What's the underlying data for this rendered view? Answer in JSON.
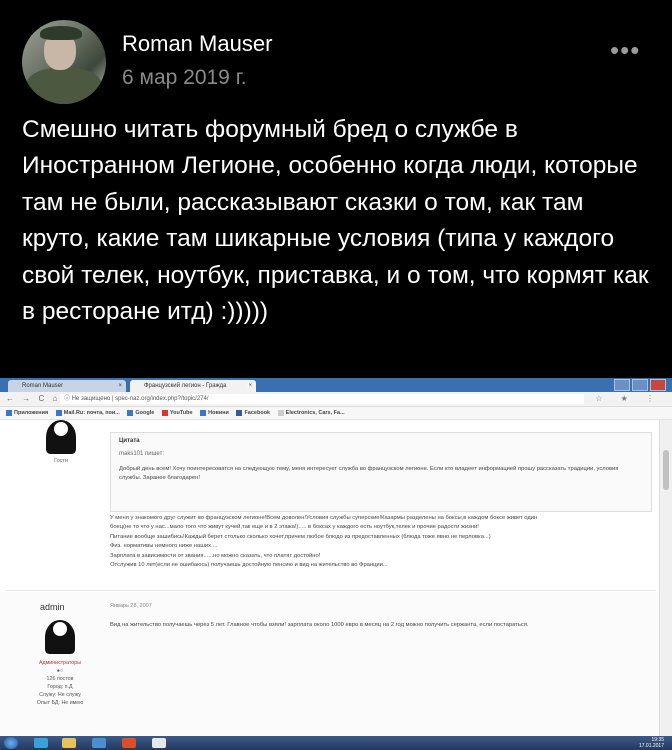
{
  "post": {
    "author": "Roman Mauser",
    "date": "6 мар 2019 г.",
    "more_glyph": "•••",
    "text": "Смешно читать форумный бред о службе в Иностранном Легионе, особенно когда люди, которые там не были, рассказывают сказки о том, как там круто, какие там шикарные условия (типа у каждого свой телек, ноутбук, приставка, и о том, что кормят как в ресторане итд) :)))))"
  },
  "browser": {
    "tabs": [
      {
        "label": "Roman Mauser",
        "close": "×"
      },
      {
        "label": "Французский легион - Гражда",
        "close": "×"
      }
    ],
    "new_tab": "+",
    "nav_glyphs": "← → C ⌂",
    "url": "ⓘ Не защищено | spec-naz.org/index.php?/topic/274/",
    "addr_icons": "☆ ★ ⋮",
    "bookmarks": [
      "Приложения",
      "Mail.Ru: почта, пои...",
      "Google",
      "YouTube",
      "Новини",
      "Facebook",
      "Electronics, Cars, Fa..."
    ]
  },
  "forum": {
    "guest_label": "Гости",
    "quote_title": "Цитата",
    "quote_author": "maks101 пишет:",
    "quote_text": "Добрый день всем! Хочу поинтересоватся на следующую тему, меня интересует служба во французском легионе. Если кто владеет информацией прошу рассказать традиции, условия службы. Заранее благодарен!",
    "message": [
      "У меня у знакомого друг служит во французском легионе!Всем доволен!Условия службы суперские!Казармы разделены на боксы,в каждом боксе живет один",
      "боец(не то что у нас...мало того что живут кучей,так еще и в 2 этажа!)..... в боксах у каждого есть ноутбук,телек и прочие радости жизни!",
      "Питание вообще зашибись!Каждый берет столько сколько хочет,причем любое блюдо из предоставленных (блюда тоже явно не перловка...)",
      "Физ. нормативы немного ниже наших....",
      "Зарплата в зависимости от звания......но можно сказать, что платят достойно!",
      "Отслужив 10 лет(если не ошибаюсь) получаешь достойную пенсию и вид на жительство во Франции..."
    ],
    "post2": {
      "author": "admin",
      "date": "Январь 28, 2007",
      "text": "Вид на жительство получаешь через 5 лет. Главное чтобы взяли! зарплата около 1000 евро в месяц на 2 год можно получить сержанта, если постараться.",
      "role": "Администраторы",
      "rank": "●○",
      "posts": "126 постов",
      "city": "Город: п.Д",
      "service": "Служу: Не служу",
      "experience": "Опыт БД: Не имею"
    }
  },
  "taskbar": {
    "clock_time": "19:35",
    "clock_date": "17.01.2017"
  }
}
